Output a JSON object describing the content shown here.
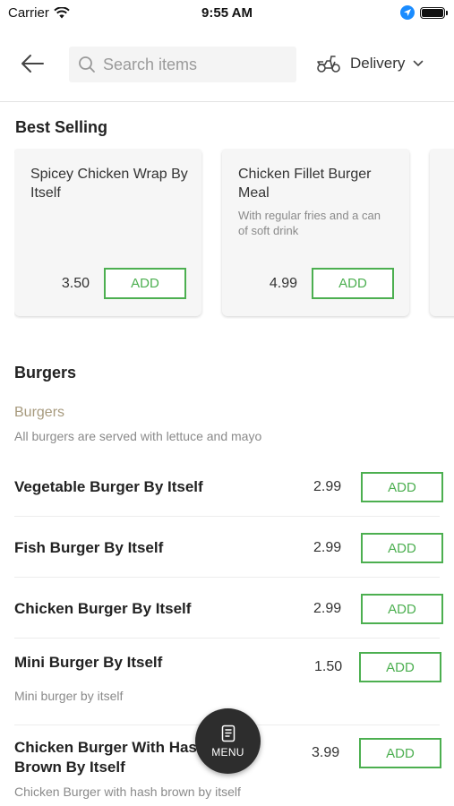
{
  "status_bar": {
    "carrier": "Carrier",
    "time": "9:55 AM"
  },
  "header": {
    "search_placeholder": "Search items",
    "delivery_label": "Delivery"
  },
  "best_selling": {
    "title": "Best Selling",
    "cards": [
      {
        "name": "Spicey Chicken Wrap By Itself",
        "description": "",
        "price": "3.50",
        "add_label": "ADD"
      },
      {
        "name": "Chicken Fillet Burger Meal",
        "description": "With regular fries and a can of soft drink",
        "price": "4.99",
        "add_label": "ADD"
      }
    ]
  },
  "burgers": {
    "title": "Burgers",
    "subcategory": "Burgers",
    "subcategory_description": "All burgers are served with lettuce and mayo",
    "items": [
      {
        "name": "Vegetable Burger By Itself",
        "price": "2.99",
        "add_label": "ADD",
        "description": ""
      },
      {
        "name": "Fish Burger By Itself",
        "price": "2.99",
        "add_label": "ADD",
        "description": ""
      },
      {
        "name": "Chicken Burger By Itself",
        "price": "2.99",
        "add_label": "ADD",
        "description": ""
      },
      {
        "name": "Mini Burger By Itself",
        "price": "1.50",
        "add_label": "ADD",
        "description": "Mini burger by itself"
      },
      {
        "name": "Chicken Burger With Hash Brown By Itself",
        "price": "3.99",
        "add_label": "ADD",
        "description": "Chicken Burger with hash brown by itself"
      }
    ]
  },
  "fab": {
    "label": "MENU"
  },
  "colors": {
    "accent": "#4caf50",
    "subcategory": "#a79a7e",
    "fab": "#2d2d2d"
  }
}
